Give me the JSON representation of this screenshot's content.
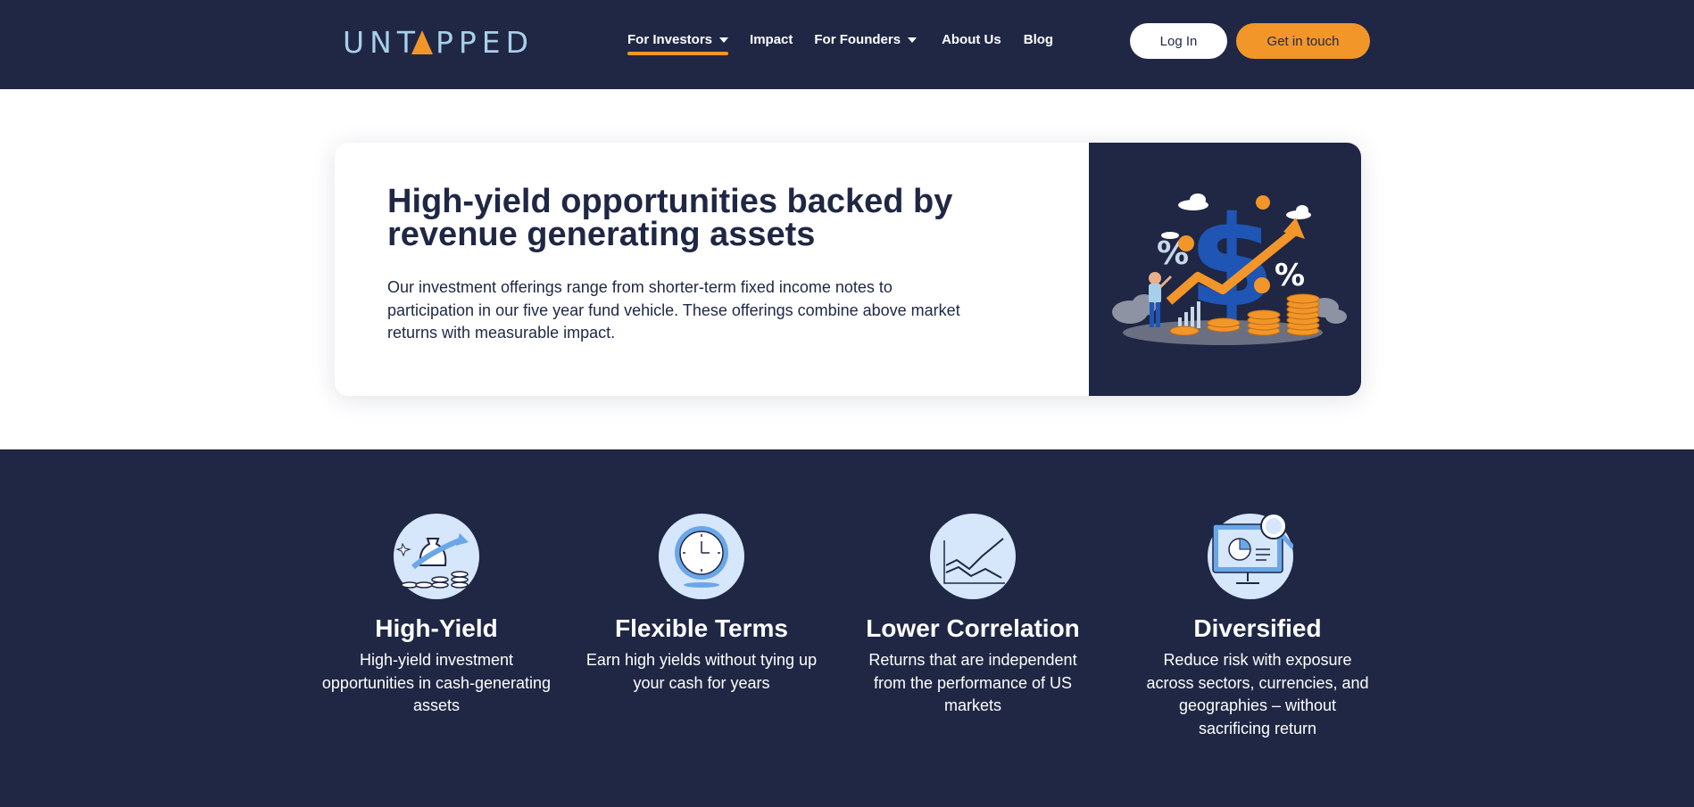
{
  "header": {
    "logo": "UNTAPPED",
    "nav": [
      {
        "label": "For Investors",
        "has_dropdown": true,
        "active": true
      },
      {
        "label": "Impact",
        "has_dropdown": false,
        "active": false
      },
      {
        "label": "For Founders",
        "has_dropdown": true,
        "active": false
      },
      {
        "label": "About Us",
        "has_dropdown": false,
        "active": false
      },
      {
        "label": "Blog",
        "has_dropdown": false,
        "active": false
      }
    ],
    "login_label": "Log In",
    "contact_label": "Get in touch"
  },
  "hero": {
    "title": "High-yield opportunities backed by revenue generating assets",
    "description": "Our investment offerings range from shorter-term fixed income notes to participation in our five year fund vehicle. These offerings combine above market returns with measurable impact.",
    "illustration": "dollar-growth-illustration"
  },
  "features": [
    {
      "title": "High-Yield",
      "description": "High-yield investment opportunities in cash-generating assets",
      "icon": "money-bag-coins-icon"
    },
    {
      "title": "Flexible Terms",
      "description": "Earn high yields without tying up your cash for years",
      "icon": "clock-icon"
    },
    {
      "title": "Lower Correlation",
      "description": "Returns that are independent from the performance of US markets",
      "icon": "line-chart-icon"
    },
    {
      "title": "Diversified",
      "description": "Reduce risk with exposure across sectors, currencies, and geographies – without sacrificing return",
      "icon": "monitor-analytics-icon"
    }
  ],
  "colors": {
    "navy": "#1f2744",
    "accent_orange": "#f2962a",
    "logo_blue": "#a8cfea",
    "icon_bg": "#d6e6fb"
  }
}
